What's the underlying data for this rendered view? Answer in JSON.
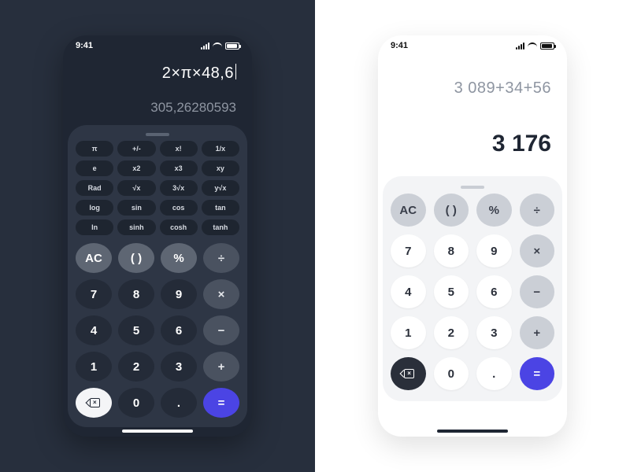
{
  "status": {
    "time": "9:41"
  },
  "dark": {
    "expression": "2×π×48,6",
    "result": "305,26280593",
    "sci": {
      "r1": [
        "π",
        "+/-",
        "x!",
        "1/x"
      ],
      "r2": [
        "e",
        "x2",
        "x3",
        "xy"
      ],
      "r3": [
        "Rad",
        "√x",
        "3√x",
        "y√x"
      ],
      "r4": [
        "log",
        "sin",
        "cos",
        "tan"
      ],
      "r5": [
        "ln",
        "sinh",
        "cosh",
        "tanh"
      ]
    }
  },
  "light": {
    "expression": "3 089+34+56",
    "result": "3 176"
  },
  "keys": {
    "ac": "AC",
    "paren": "( )",
    "percent": "%",
    "div": "÷",
    "mul": "×",
    "sub": "−",
    "add": "+",
    "eq": "=",
    "dot": ".",
    "n0": "0",
    "n1": "1",
    "n2": "2",
    "n3": "3",
    "n4": "4",
    "n5": "5",
    "n6": "6",
    "n7": "7",
    "n8": "8",
    "n9": "9"
  }
}
